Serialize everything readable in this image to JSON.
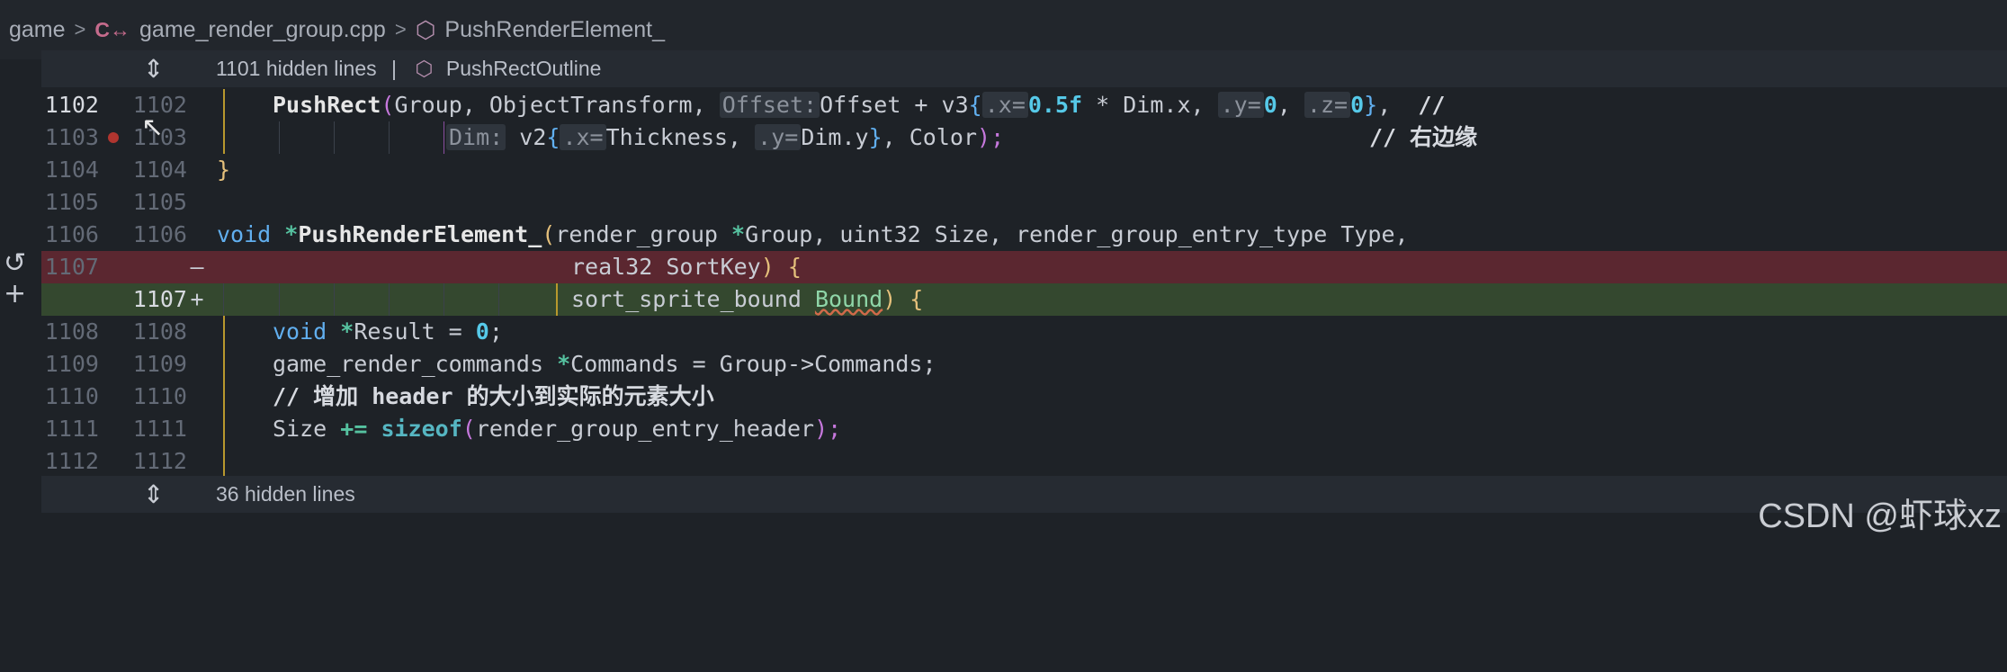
{
  "breadcrumb": {
    "folder": "game",
    "file_icon": "C↔",
    "file": "game_render_group.cpp",
    "symbol_icon": "⬡",
    "symbol": "PushRenderElement_"
  },
  "fold_top": {
    "icon": "⇕",
    "text": "1101 hidden lines",
    "divider": "|",
    "symbol_icon": "⬡",
    "symbol": "PushRectOutline"
  },
  "fold_bottom": {
    "icon": "⇕",
    "text": "36 hidden lines"
  },
  "edge_icons": {
    "revert": "↺",
    "stage": "+"
  },
  "lines": [
    {
      "old": "1102",
      "new": "1102"
    },
    {
      "old": "1103",
      "new": "1103"
    },
    {
      "old": "1104",
      "new": "1104"
    },
    {
      "old": "1105",
      "new": "1105"
    },
    {
      "old": "1106",
      "new": "1106"
    },
    {
      "old": "1107",
      "new": "",
      "mark": "—"
    },
    {
      "old": "",
      "new": "1107",
      "mark": "+"
    },
    {
      "old": "1108",
      "new": "1108"
    },
    {
      "old": "1109",
      "new": "1109"
    },
    {
      "old": "1110",
      "new": "1110"
    },
    {
      "old": "1111",
      "new": "1111"
    },
    {
      "old": "1112",
      "new": "1112"
    }
  ],
  "code": {
    "l1102": {
      "fn": "PushRect",
      "p1": "(",
      "a1": "Group, ObjectTransform, ",
      "hint1": "Offset:",
      "a2": "Offset + v3",
      "b1": "{",
      "hint2": ".x=",
      "n1": "0.5f",
      "a3": " * Dim.x, ",
      "hint3": ".y=",
      "n2": "0",
      "a4": ", ",
      "hint4": ".z=",
      "n3": "0",
      "b2": "}",
      "a5": ",  ",
      "cmt": "//"
    },
    "l1103": {
      "hint1": "Dim:",
      "a1": " v2",
      "b1": "{",
      "hint2": ".x=",
      "a2": "Thickness, ",
      "hint3": ".y=",
      "a3": "Dim.y",
      "b2": "}",
      "a4": ", Color",
      "p1": ");",
      "cmt": "// 右边缘"
    },
    "l1104": {
      "b": "}"
    },
    "l1106": {
      "kw": "void",
      "star": " *",
      "fn": "PushRenderElement_",
      "p1": "(",
      "a1": "render_group ",
      "star2": "*",
      "a2": "Group, uint32 Size, render_group_entry_type Type,"
    },
    "l1107_old": {
      "a1": "real32 SortKey",
      "p1": ") {"
    },
    "l1107_new": {
      "a1": "sort_sprite_bound ",
      "a2": "Bound",
      "p1": ") {"
    },
    "l1108": {
      "kw": "void",
      "star": " *",
      "a1": "Result = ",
      "n1": "0",
      "a2": ";"
    },
    "l1109": {
      "a1": "game_render_commands ",
      "star": "*",
      "a2": "Commands = Group->Commands;"
    },
    "l1110": {
      "cmt": "// 增加 header 的大小到实际的元素大小"
    },
    "l1111": {
      "a1": "Size ",
      "op": "+=",
      "sp": " ",
      "kw": "sizeof",
      "p1": "(",
      "a2": "render_group_entry_header",
      "p2": ");"
    }
  },
  "watermark": "CSDN @虾球xz",
  "colors": {
    "background": "#1e2227",
    "deleted_line": "#5b2730",
    "added_line": "#34482f",
    "keyword": "#61afef",
    "number": "#56c9e8"
  }
}
